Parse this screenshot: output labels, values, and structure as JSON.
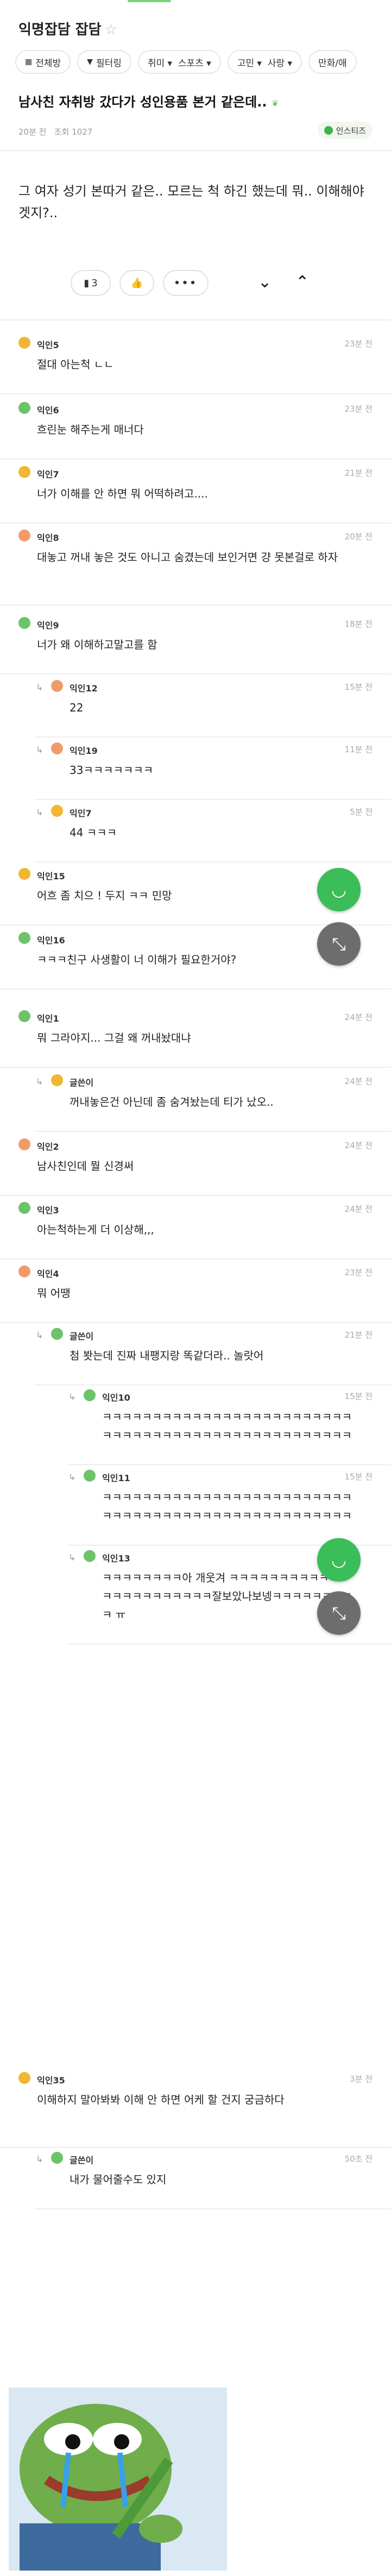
{
  "board": {
    "title": "익명잡담 잡담",
    "star": "☆"
  },
  "filters": [
    {
      "label": "전체방",
      "icon": "grid-icon"
    },
    {
      "label": "필터링",
      "icon": "filter-icon"
    },
    {
      "label": "취미 ▾  스포츠 ▾"
    },
    {
      "label": "고민 ▾  사랑 ▾"
    },
    {
      "label": "만화/애"
    }
  ],
  "post": {
    "title": "남사친 자취방 갔다가 성인용품 본거 같은데..",
    "meta": "20분 전   조회 1027",
    "channel": "인스티즈",
    "body": "그 여자 성기 본따거 같은.. 모르는 척 하긴 했는데 뭐.. 이해해야 겟지?..",
    "bookmark_count": "3"
  },
  "comments": [
    {
      "name": "익인5",
      "time": "23분 전",
      "text": "절대 아는척 ㄴㄴ"
    },
    {
      "name": "익인6",
      "time": "23분 전",
      "text": "흐린눈 해주는게 매너다"
    },
    {
      "name": "익인7",
      "time": "21분 전",
      "text": "너가 이해를 안 하면 뭐 어떡하려고...."
    },
    {
      "name": "익인8",
      "time": "20분 전",
      "text": "대놓고 꺼내 놓은 것도 아니고 숨겼는데 보인거면 걍 못본걸로 하자"
    },
    {
      "name": "익인9",
      "time": "18분 전",
      "text": "너가 왜 이해하고말고를 함"
    },
    {
      "name": "익인12",
      "time": "15분 전",
      "text": "22"
    },
    {
      "name": "익인19",
      "time": "11분 전",
      "text": "33ㅋㅋㅋㅋㅋㅋㅋ"
    },
    {
      "name": "익인7",
      "time": "5분 전",
      "text": "44 ㅋㅋㅋ"
    },
    {
      "name": "익인15",
      "time": "",
      "text": "어흐 좀 치으 ! 두지 ㅋㅋ 민망"
    },
    {
      "name": "익인16",
      "time": "",
      "text": "ㅋㅋㅋ친구 사생활이 너 이해가 필요한거야?"
    },
    {
      "name": "익인1",
      "time": "24분 전",
      "text": "뭐 그라야지... 그걸 왜 꺼내놨대냐"
    },
    {
      "name": "글쓴이",
      "time": "24분 전",
      "text": "꺼내놓은건 아닌데 좀 숨겨놨는데 티가 났오.."
    },
    {
      "name": "익인2",
      "time": "24분 전",
      "text": "남사친인데 뭘 신경써"
    },
    {
      "name": "익인3",
      "time": "24분 전",
      "text": "아는척하는게 더 이상해,,,"
    },
    {
      "name": "익인4",
      "time": "23분 전",
      "text": "뭐 어땡"
    },
    {
      "name": "글쓴이",
      "time": "21분 전",
      "text": "첨 봣는데 진짜 내팽지랑 똑같더라.. 놀랏어"
    },
    {
      "name": "익인10",
      "time": "15분 전",
      "text": "ㅋㅋㅋㅋㅋㅋㅋㅋㅋㅋㅋㅋㅋㅋㅋㅋㅋㅋㅋㅋㅋㅋㅋㅋㅋㅋㅋㅋㅋㅋㅋㅋㅋㅋㅋㅋㅋㅋㅋㅋㅋㅋㅋㅋㅋㅋㅋㅋㅋㅋ"
    },
    {
      "name": "익인11",
      "time": "15분 전",
      "text": "ㅋㅋㅋㅋㅋㅋㅋㅋㅋㅋㅋㅋㅋㅋㅋㅋㅋㅋㅋㅋㅋㅋㅋㅋㅋㅋㅋㅋㅋㅋㅋㅋㅋㅋㅋㅋㅋㅋㅋㅋㅋㅋㅋㅋㅋㅋㅋㅋㅋㅋ"
    },
    {
      "name": "익인13",
      "time": "",
      "text": "ㅋㅋㅋㅋㅋㅋㅋㅋ아 개웃겨 ㅋㅋㅋㅋㅋㅋㅋㅋㅋㅋㅋㅋ ㅋㅋㅋㅋㅋㅋㅋㅋㅋㅋㅋ잘보았나보넹ㅋㅋㅋㅋㅋㅋㅋㅋㅋ ㅠ"
    },
    {
      "name": "익인35",
      "time": "3분 전",
      "text": "이해하지 말아봐봐 이해 안 하면 어케 할 건지 궁금하다"
    },
    {
      "name": "글쓴이",
      "time": "50초 전",
      "text": "내가 물어줄수도 있지"
    }
  ],
  "colors": {
    "accent": "#3bbd5a",
    "fab_gray": "#6d6d6d"
  }
}
